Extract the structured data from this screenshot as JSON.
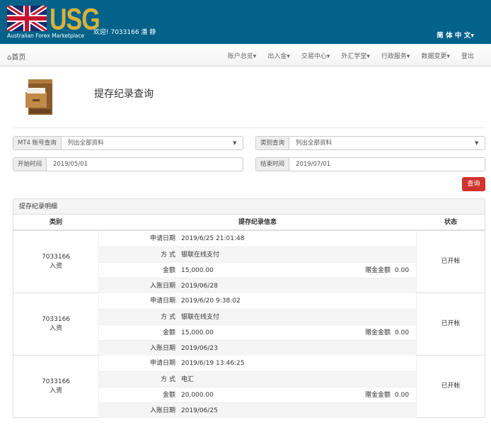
{
  "header": {
    "logo_text": "USG",
    "tagline": "Australian Forex Marketplace",
    "welcome": "欢迎! 7033166 潘 静",
    "language": "简 体 中 文▾"
  },
  "nav": {
    "home": "首页",
    "items": [
      "账户总览▾",
      "出入金▾",
      "交易中心▾",
      "外汇学堂▾",
      "行政服务▾",
      "数据变更▾",
      "登出"
    ]
  },
  "page_title": "提存纪录查询",
  "filters": {
    "account": {
      "label": "MT4 账号查询",
      "value": "列出全部资料"
    },
    "category": {
      "label": "类别查询",
      "value": "列出全部资料"
    },
    "start": {
      "label": "开始时间",
      "value": "2019/05/01"
    },
    "end": {
      "label": "结束时间",
      "value": "2019/07/01"
    },
    "submit": "查询"
  },
  "panel": {
    "heading": "提存纪录明细",
    "columns": [
      "类别",
      "提存纪录信息",
      "状态"
    ],
    "labels": {
      "apply": "申请日期",
      "method": "方 式",
      "amount": "金额",
      "bonus": "赠金金额",
      "credit": "入账日期"
    },
    "records": [
      {
        "account": "7033166",
        "type": "入资",
        "apply": "2019/6/25 21:01:48",
        "method": "银联在线支付",
        "amount": "15,000.00",
        "bonus": "0.00",
        "credit": "2019/06/28",
        "status": "已开帐"
      },
      {
        "account": "7033166",
        "type": "入资",
        "apply": "2019/6/20 9:38:02",
        "method": "银联在线支付",
        "amount": "15,000.00",
        "bonus": "0.00",
        "credit": "2019/06/23",
        "status": "已开帐"
      },
      {
        "account": "7033166",
        "type": "入资",
        "apply": "2019/6/19 13:46:25",
        "method": "电汇",
        "amount": "20,000.00",
        "bonus": "0.00",
        "credit": "2019/06/25",
        "status": "已开帐"
      }
    ]
  }
}
